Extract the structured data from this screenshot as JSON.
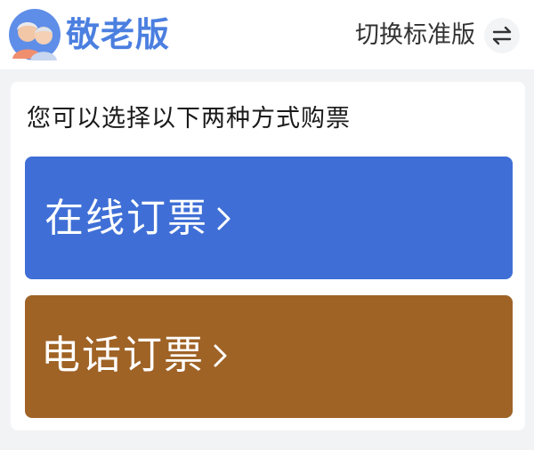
{
  "header": {
    "brand_title": "敬老版",
    "switch_label": "切换标准版",
    "logo_icon": "elderly-couple-avatar-icon",
    "switch_icon": "swap-arrows-icon",
    "brand_color": "#4b7fe0"
  },
  "main": {
    "subtitle": "您可以选择以下两种方式购票",
    "buttons": [
      {
        "label": "在线订票",
        "color": "#3f6fd6",
        "icon": "chevron-right-icon"
      },
      {
        "label": "电话订票",
        "color": "#9f6326",
        "icon": "chevron-right-icon"
      }
    ]
  }
}
